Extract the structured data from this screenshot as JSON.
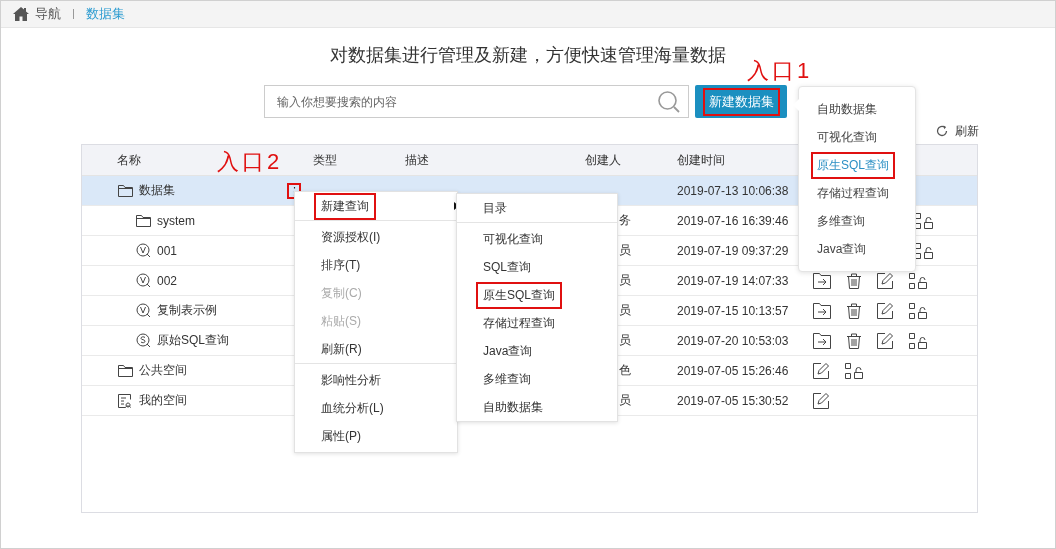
{
  "breadcrumb": [
    {
      "label": "导航",
      "kind": "home",
      "selected": false
    },
    {
      "label": "数据集",
      "kind": "plain",
      "selected": true
    }
  ],
  "heading": "对数据集进行管理及新建，方便快速管理海量数据",
  "search": {
    "placeholder": "输入你想要搜索的内容"
  },
  "new_button": {
    "label": "新建数据集",
    "boxed": true
  },
  "refresh": "刷新",
  "annotations": [
    {
      "text": "入口1"
    },
    {
      "text": "入口2"
    }
  ],
  "table": {
    "columns": [
      "名称",
      "类型",
      "描述",
      "创建人",
      "创建时间"
    ],
    "rows": [
      {
        "name": "数据集",
        "kind": "folder",
        "selected": true,
        "menu": "⋮",
        "created": "2019-07-13 10:06:38",
        "children": [
          {
            "name": "system",
            "kind": "folder",
            "selected": false,
            "creator": "务",
            "created": "2019-07-16 16:39:46",
            "actions": [
              {
                "kind": "lock"
              }
            ]
          },
          {
            "name": "001",
            "kind": "view",
            "selected": false,
            "creator": "员",
            "created": "2019-07-19 09:37:29",
            "actions": [
              {
                "kind": "lock"
              }
            ]
          },
          {
            "name": "002",
            "kind": "view",
            "selected": false,
            "creator": "员",
            "created": "2019-07-19 14:07:33",
            "actions": [
              {
                "kind": "move"
              },
              {
                "kind": "delete"
              },
              {
                "kind": "edit"
              },
              {
                "kind": "lock"
              }
            ]
          },
          {
            "name": "复制表示例",
            "kind": "view",
            "selected": false,
            "creator": "员",
            "created": "2019-07-15 10:13:57",
            "actions": [
              {
                "kind": "move"
              },
              {
                "kind": "delete"
              },
              {
                "kind": "edit"
              },
              {
                "kind": "lock"
              }
            ]
          },
          {
            "name": "原始SQL查询",
            "kind": "sql",
            "selected": false,
            "creator": "员",
            "created": "2019-07-20 10:53:03",
            "actions": [
              {
                "kind": "move"
              },
              {
                "kind": "delete"
              },
              {
                "kind": "edit"
              },
              {
                "kind": "lock"
              }
            ]
          }
        ]
      },
      {
        "name": "公共空间",
        "kind": "folder",
        "selected": false,
        "creator": "色",
        "created": "2019-07-05 15:26:46",
        "actions": [
          {
            "kind": "edit"
          },
          {
            "kind": "lock"
          }
        ]
      },
      {
        "name": "我的空间",
        "kind": "personal",
        "selected": false,
        "creator": "员",
        "created": "2019-07-05 15:30:52",
        "actions": [
          {
            "kind": "edit"
          }
        ]
      }
    ]
  },
  "context_menu": {
    "items": [
      {
        "label": "新建查询",
        "kind": "submenu",
        "disabled": false,
        "boxed": true
      },
      {
        "kind": "divider"
      },
      {
        "label": "资源授权(I)",
        "kind": "item",
        "disabled": false,
        "boxed": false
      },
      {
        "label": "排序(T)",
        "kind": "item",
        "disabled": false,
        "boxed": false
      },
      {
        "label": "复制(C)",
        "kind": "item",
        "disabled": true,
        "boxed": false
      },
      {
        "label": "粘贴(S)",
        "kind": "item",
        "disabled": true,
        "boxed": false
      },
      {
        "label": "刷新(R)",
        "kind": "item",
        "disabled": false,
        "boxed": false
      },
      {
        "kind": "divider"
      },
      {
        "label": "影响性分析",
        "kind": "item",
        "disabled": false,
        "boxed": false
      },
      {
        "label": "血统分析(L)",
        "kind": "item",
        "disabled": false,
        "boxed": false
      },
      {
        "label": "属性(P)",
        "kind": "item",
        "disabled": false,
        "boxed": false
      }
    ]
  },
  "submenu": {
    "items": [
      {
        "label": "目录",
        "kind": "item",
        "boxed": false
      },
      {
        "kind": "divider"
      },
      {
        "label": "可视化查询",
        "kind": "item",
        "boxed": false
      },
      {
        "label": "SQL查询",
        "kind": "item",
        "boxed": false
      },
      {
        "label": "原生SQL查询",
        "kind": "item",
        "boxed": true
      },
      {
        "label": "存储过程查询",
        "kind": "item",
        "boxed": false
      },
      {
        "label": "Java查询",
        "kind": "item",
        "boxed": false
      },
      {
        "label": "多维查询",
        "kind": "item",
        "boxed": false
      },
      {
        "label": "自助数据集",
        "kind": "item",
        "boxed": false
      }
    ]
  },
  "dropdown": {
    "items": [
      {
        "label": "自助数据集",
        "selected": false,
        "boxed": false
      },
      {
        "label": "可视化查询",
        "selected": false,
        "boxed": false
      },
      {
        "label": "原生SQL查询",
        "selected": true,
        "boxed": true
      },
      {
        "label": "存储过程查询",
        "selected": false,
        "boxed": false
      },
      {
        "label": "多维查询",
        "selected": false,
        "boxed": false
      },
      {
        "label": "Java查询",
        "selected": false,
        "boxed": false
      }
    ]
  }
}
